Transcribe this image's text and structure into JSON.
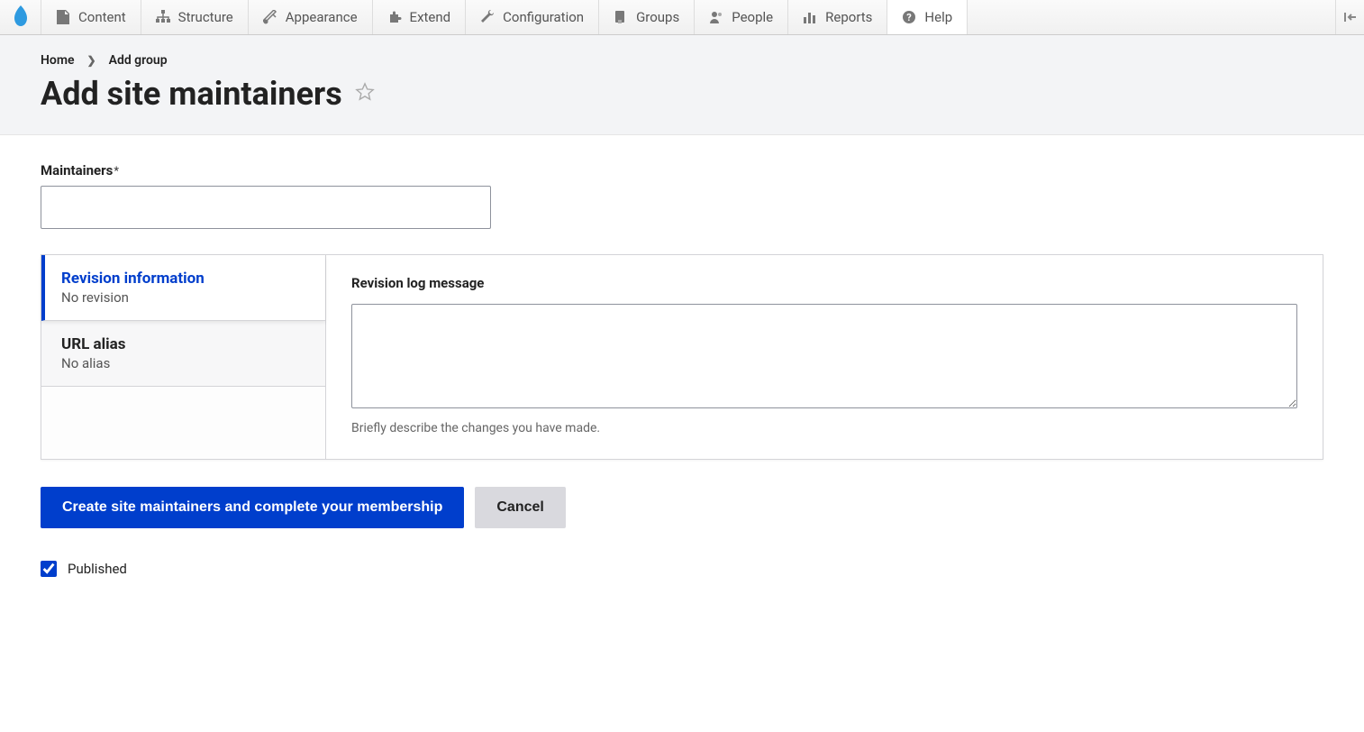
{
  "toolbar": {
    "items": [
      {
        "label": "Content",
        "icon": "content"
      },
      {
        "label": "Structure",
        "icon": "structure"
      },
      {
        "label": "Appearance",
        "icon": "appearance"
      },
      {
        "label": "Extend",
        "icon": "extend"
      },
      {
        "label": "Configuration",
        "icon": "configuration"
      },
      {
        "label": "Groups",
        "icon": "groups"
      },
      {
        "label": "People",
        "icon": "people"
      },
      {
        "label": "Reports",
        "icon": "reports"
      },
      {
        "label": "Help",
        "icon": "help"
      }
    ]
  },
  "breadcrumb": {
    "items": [
      {
        "label": "Home"
      },
      {
        "label": "Add group"
      }
    ]
  },
  "page": {
    "title": "Add site maintainers"
  },
  "form": {
    "maintainers": {
      "label": "Maintainers",
      "value": ""
    },
    "vtabs": [
      {
        "title": "Revision information",
        "summary": "No revision",
        "selected": true
      },
      {
        "title": "URL alias",
        "summary": "No alias",
        "selected": false
      }
    ],
    "revision_log": {
      "label": "Revision log message",
      "value": "",
      "description": "Briefly describe the changes you have made."
    },
    "actions": {
      "submit": "Create site maintainers and complete your membership",
      "cancel": "Cancel"
    },
    "published": {
      "label": "Published",
      "checked": true
    }
  }
}
